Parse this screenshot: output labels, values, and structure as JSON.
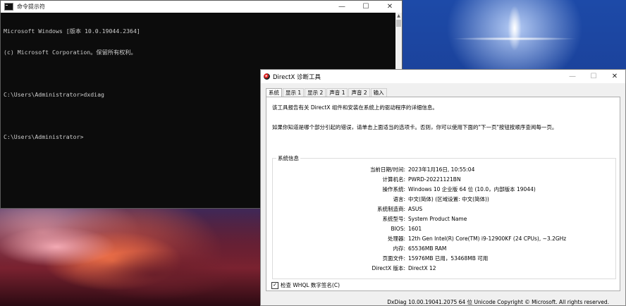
{
  "console": {
    "title": "命令提示符",
    "lines": [
      "Microsoft Windows [版本 10.0.19044.2364]",
      "(c) Microsoft Corporation。保留所有权利。",
      "",
      "C:\\Users\\Administrator>dxdiag",
      "",
      "C:\\Users\\Administrator>"
    ],
    "controls": {
      "minimize": "—",
      "maximize": "☐",
      "close": "✕"
    }
  },
  "dxdiag": {
    "title": "DirectX 诊断工具",
    "controls": {
      "minimize": "—",
      "maximize": "☐",
      "close": "✕"
    },
    "tabs": [
      "系统",
      "显示 1",
      "显示 2",
      "声音 1",
      "声音 2",
      "输入"
    ],
    "intro1": "该工具报告有关 DirectX 组件和安装在系统上的驱动程序的详细信息。",
    "intro2": "如果你知道是哪个部分引起的错误，请单击上面适当的选项卡。否则，你可以使用下面的\"下一页\"按钮按顺序查阅每一页。",
    "group_title": "系统信息",
    "info": [
      {
        "label": "当前日期/时间:",
        "value": "2023年1月16日, 10:55:04"
      },
      {
        "label": "计算机名:",
        "value": "PWRD-20221121BN"
      },
      {
        "label": "操作系统:",
        "value": "Windows 10 企业版 64 位 (10.0，内部版本 19044)"
      },
      {
        "label": "语言:",
        "value": "中文(简体) (区域设置: 中文(简体))"
      },
      {
        "label": "系统制造商:",
        "value": "ASUS"
      },
      {
        "label": "系统型号:",
        "value": "System Product Name"
      },
      {
        "label": "BIOS:",
        "value": "1601"
      },
      {
        "label": "处理器:",
        "value": "12th Gen Intel(R) Core(TM) i9-12900KF (24 CPUs), ~3.2GHz"
      },
      {
        "label": "内存:",
        "value": "65536MB RAM"
      },
      {
        "label": "页面文件:",
        "value": "15976MB 已用，53468MB 可用"
      },
      {
        "label": "DirectX 版本:",
        "value": "DirectX 12"
      }
    ],
    "whql_label": "检查 WHQL 数字签名(C)",
    "whql_checked_glyph": "✓",
    "footer": "DxDiag 10.00.19041.2075 64 位 Unicode  Copyright © Microsoft. All rights reserved."
  }
}
